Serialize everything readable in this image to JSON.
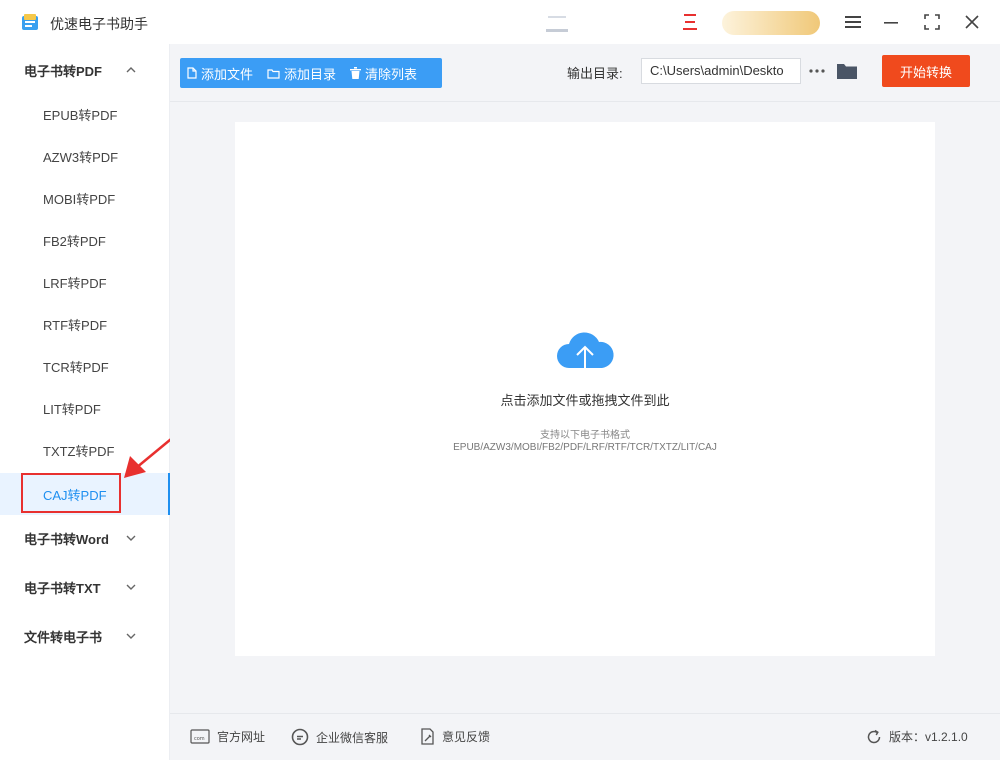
{
  "app": {
    "title": "优速电子书助手"
  },
  "sidebar": {
    "groups": [
      {
        "label": "电子书转PDF",
        "expanded": true
      },
      {
        "label": "电子书转Word",
        "expanded": false
      },
      {
        "label": "电子书转TXT",
        "expanded": false
      },
      {
        "label": "文件转电子书",
        "expanded": false
      }
    ],
    "items": [
      {
        "label": "EPUB转PDF"
      },
      {
        "label": "AZW3转PDF"
      },
      {
        "label": "MOBI转PDF"
      },
      {
        "label": "FB2转PDF"
      },
      {
        "label": "LRF转PDF"
      },
      {
        "label": "RTF转PDF"
      },
      {
        "label": "TCR转PDF"
      },
      {
        "label": "LIT转PDF"
      },
      {
        "label": "TXTZ转PDF"
      },
      {
        "label": "CAJ转PDF",
        "active": true
      }
    ]
  },
  "toolbar": {
    "add_file": "添加文件",
    "add_dir": "添加目录",
    "clear_list": "清除列表",
    "output_label": "输出目录:",
    "output_path": "C:\\Users\\admin\\Deskto",
    "more": "···",
    "start": "开始转换"
  },
  "dropzone": {
    "hint": "点击添加文件或拖拽文件到此",
    "sub": "支持以下电子书格式",
    "formats": "EPUB/AZW3/MOBI/FB2/PDF/LRF/RTF/TCR/TXTZ/LIT/CAJ"
  },
  "footer": {
    "website": "官方网址",
    "wechat": "企业微信客服",
    "feedback": "意见反馈",
    "version": "版本：v1.2.1.0"
  },
  "colors": {
    "accent": "#3b9df5",
    "start": "#f04a1d",
    "highlight": "#e8302f",
    "active_text": "#1e8ff0"
  }
}
